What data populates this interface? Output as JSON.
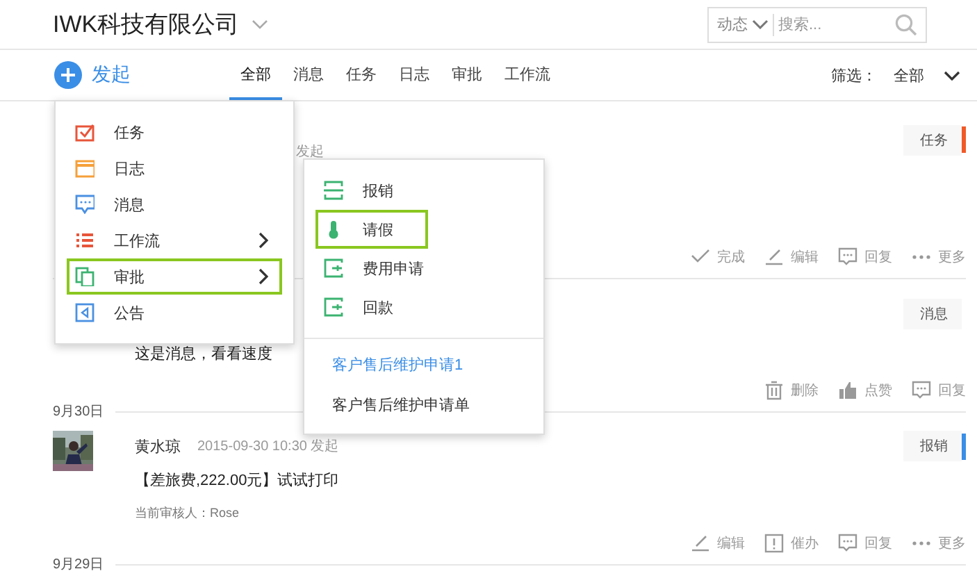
{
  "header": {
    "company": "IWK科技有限公司",
    "search_scope": "动态",
    "search_placeholder": "搜索..."
  },
  "launch": {
    "label": "发起"
  },
  "tabs": [
    {
      "label": "全部",
      "selected": true
    },
    {
      "label": "消息",
      "selected": false
    },
    {
      "label": "任务",
      "selected": false
    },
    {
      "label": "日志",
      "selected": false
    },
    {
      "label": "审批",
      "selected": false
    },
    {
      "label": "工作流",
      "selected": false
    }
  ],
  "filter": {
    "label": "筛选：",
    "value": "全部"
  },
  "feed": [
    {
      "meta": "发起",
      "tag": "任务",
      "color": "#f05a28",
      "actions": [
        {
          "kind": "complete",
          "label": "完成"
        },
        {
          "kind": "edit",
          "label": "编辑"
        },
        {
          "kind": "reply",
          "label": "回复"
        },
        {
          "kind": "more",
          "label": "更多"
        }
      ]
    },
    {
      "text": "这是消息，看看速度",
      "tag": "消息",
      "actions": [
        {
          "kind": "delete",
          "label": "删除"
        },
        {
          "kind": "like",
          "label": "点赞"
        },
        {
          "kind": "reply",
          "label": "回复"
        }
      ]
    },
    {
      "date": "9月30日",
      "name": "黄水琼",
      "meta": "2015-09-30 10:30 发起",
      "text": "【差旅费,222.00元】试试打印",
      "reviewer": "当前审核人：Rose",
      "tag": "报销",
      "color": "#3a8ee6",
      "actions": [
        {
          "kind": "edit",
          "label": "编辑"
        },
        {
          "kind": "urge",
          "label": "催办"
        },
        {
          "kind": "reply",
          "label": "回复"
        },
        {
          "kind": "more",
          "label": "更多"
        }
      ]
    },
    {
      "date": "9月29日"
    }
  ],
  "launch_menu": [
    {
      "label": "任务",
      "has_submenu": false,
      "selected": false
    },
    {
      "label": "日志",
      "has_submenu": false,
      "selected": false
    },
    {
      "label": "消息",
      "has_submenu": false,
      "selected": false
    },
    {
      "label": "工作流",
      "has_submenu": true,
      "selected": false
    },
    {
      "label": "审批",
      "has_submenu": true,
      "selected": true
    },
    {
      "label": "公告",
      "has_submenu": false,
      "selected": false
    }
  ],
  "approval_menu": [
    {
      "label": "报销",
      "selected": false
    },
    {
      "label": "请假",
      "selected": true
    },
    {
      "label": "费用申请",
      "selected": false
    },
    {
      "label": "回款",
      "selected": false
    }
  ],
  "approval_custom": [
    {
      "label": "客户售后维护申请1",
      "link": true
    },
    {
      "label": "客户售后维护申请单",
      "link": false
    }
  ]
}
